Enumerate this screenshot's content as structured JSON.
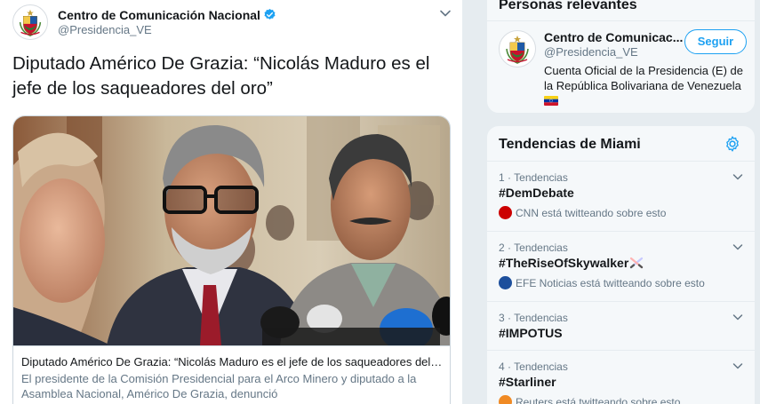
{
  "tweet": {
    "author_name": "Centro de Comunicación Nacional",
    "author_handle": "@Presidencia_VE",
    "text": "Diputado Américo De Grazia: “Nicolás Maduro es el jefe de los saqueadores del oro”",
    "card": {
      "title": "Diputado Américo De Grazia: “Nicolás Maduro es el jefe de los saqueadores del oro”",
      "description": "El presidente de la Comisión Presidencial para el Arco Minero y diputado a la Asamblea Nacional, Américo De Grazia, denunció",
      "photo_alt": "photo of Américo De Grazia with colleagues in front of microphones"
    }
  },
  "relevant": {
    "heading": "Personas relevantes",
    "name": "Centro de Comunicac...",
    "handle": "@Presidencia_VE",
    "follow_label": "Seguir",
    "bio": "Cuenta Oficial de la Presidencia (E) de la República Bolivariana de Venezuela"
  },
  "trends": {
    "heading": "Tendencias de Miami",
    "items": [
      {
        "rank": "1",
        "category": "Tendencias",
        "tag": "#DemDebate",
        "source": "CNN está twitteando sobre esto",
        "source_logo": "cnn-logo"
      },
      {
        "rank": "2",
        "category": "Tendencias",
        "tag": "#TheRiseOfSkywalker",
        "source": "EFE Noticias está twitteando sobre esto",
        "source_logo": "efe-logo"
      },
      {
        "rank": "3",
        "category": "Tendencias",
        "tag": "#IMPOTUS"
      },
      {
        "rank": "4",
        "category": "Tendencias",
        "tag": "#Starliner",
        "source": "Reuters está twitteando sobre esto",
        "source_logo": "reuters-logo"
      }
    ]
  },
  "colors": {
    "accent": "#1da1f2",
    "text_primary": "#14171a",
    "text_secondary": "#657786",
    "panel_bg": "#f5f8fa",
    "cnn_red": "#cc0000",
    "efe_blue": "#1d4f9c"
  },
  "icons": [
    "venezuela-seal-icon",
    "verified-icon",
    "chevron-down-icon",
    "gear-icon",
    "crossed-lightsabers-icon",
    "venezuela-flag-icon"
  ]
}
